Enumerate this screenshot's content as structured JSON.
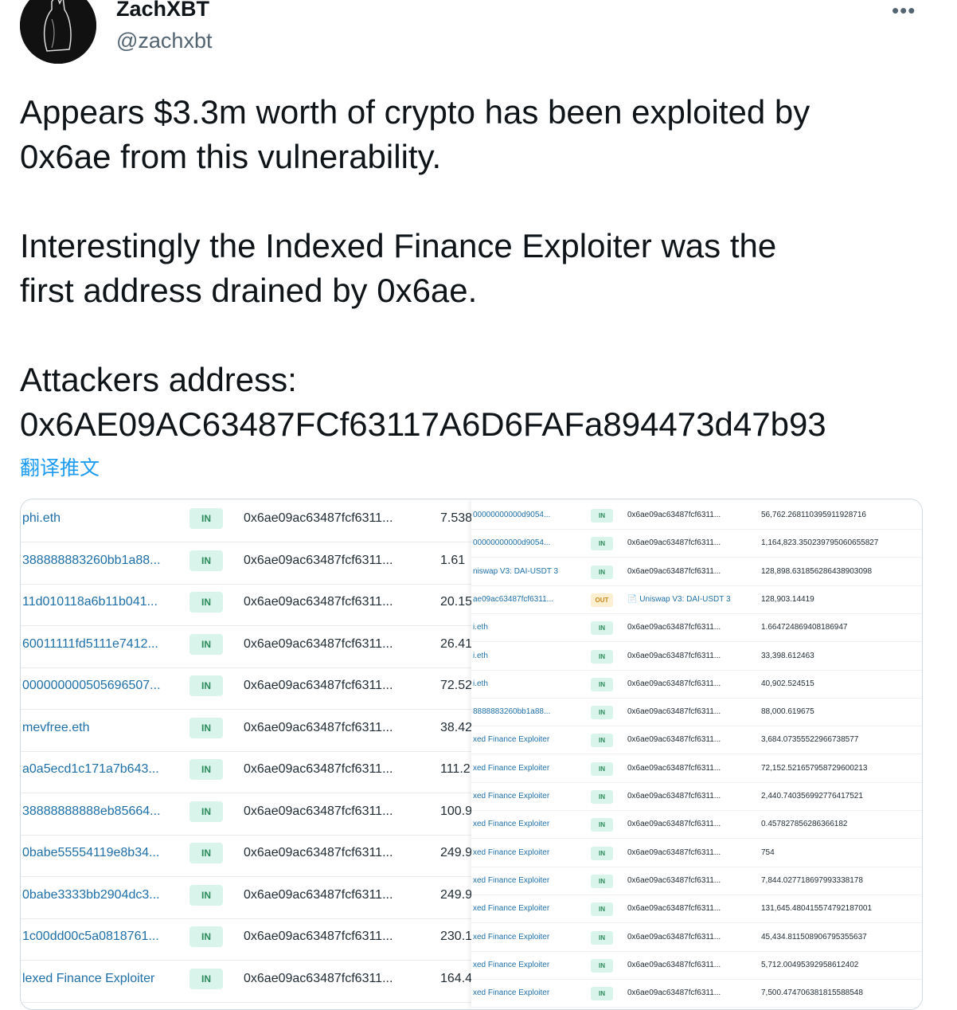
{
  "author": {
    "display_name": "ZachXBT",
    "handle": "@zachxbt"
  },
  "more_label": "•••",
  "tweet": {
    "text": "Appears $3.3m worth of crypto has been exploited by\n0x6ae from this vulnerability.\n\nInterestingly the Indexed Finance Exploiter was the\nfirst address drained by 0x6ae.\n\nAttackers address:\n0x6AE09AC63487FCf63117A6D6FAFa894473d47b93",
    "translate_label": "翻译推文"
  },
  "left_table": {
    "rows": [
      {
        "from": "phi.eth",
        "dir": "IN",
        "to": "0x6ae09ac63487fcf6311...",
        "amount": "7.538"
      },
      {
        "from": "388888883260bb1a88...",
        "dir": "IN",
        "to": "0x6ae09ac63487fcf6311...",
        "amount": "1.61"
      },
      {
        "from": "11d010118a6b11b041...",
        "dir": "IN",
        "to": "0x6ae09ac63487fcf6311...",
        "amount": "20.15"
      },
      {
        "from": "60011111fd5111e7412...",
        "dir": "IN",
        "to": "0x6ae09ac63487fcf6311...",
        "amount": "26.41"
      },
      {
        "from": "000000000505696507...",
        "dir": "IN",
        "to": "0x6ae09ac63487fcf6311...",
        "amount": "72.52"
      },
      {
        "from": "mevfree.eth",
        "dir": "IN",
        "to": "0x6ae09ac63487fcf6311...",
        "amount": "38.42"
      },
      {
        "from": "a0a5ecd1c171a7b643...",
        "dir": "IN",
        "to": "0x6ae09ac63487fcf6311...",
        "amount": "111.2"
      },
      {
        "from": "38888888888eb85664...",
        "dir": "IN",
        "to": "0x6ae09ac63487fcf6311...",
        "amount": "100.9"
      },
      {
        "from": "0babe55554119e8b34...",
        "dir": "IN",
        "to": "0x6ae09ac63487fcf6311...",
        "amount": "249.9"
      },
      {
        "from": "0babe3333bb2904dc3...",
        "dir": "IN",
        "to": "0x6ae09ac63487fcf6311...",
        "amount": "249.9"
      },
      {
        "from": "1c00dd00c5a0818761...",
        "dir": "IN",
        "to": "0x6ae09ac63487fcf6311...",
        "amount": "230.1"
      },
      {
        "from": "lexed Finance Exploiter",
        "dir": "IN",
        "to": "0x6ae09ac63487fcf6311...",
        "amount": "164.4"
      }
    ]
  },
  "right_table": {
    "rows": [
      {
        "from": "00000000000d9054...",
        "dir": "IN",
        "to": "0x6ae09ac63487fcf6311...",
        "amount": "56,762.268110395911928716"
      },
      {
        "from": "00000000000d9054...",
        "dir": "IN",
        "to": "0x6ae09ac63487fcf6311...",
        "amount": "1,164,823.350239795060655827"
      },
      {
        "from": "niswap V3: DAI-USDT 3",
        "dir": "IN",
        "to": "0x6ae09ac63487fcf6311...",
        "amount": "128,898.631856286438903098"
      },
      {
        "from": "ae09ac63487fcf6311...",
        "dir": "OUT",
        "to": "Uniswap V3: DAI-USDT 3",
        "amount": "128,903.14419"
      },
      {
        "from": "i.eth",
        "dir": "IN",
        "to": "0x6ae09ac63487fcf6311...",
        "amount": "1.664724869408186947"
      },
      {
        "from": "i.eth",
        "dir": "IN",
        "to": "0x6ae09ac63487fcf6311...",
        "amount": "33,398.612463"
      },
      {
        "from": "i.eth",
        "dir": "IN",
        "to": "0x6ae09ac63487fcf6311...",
        "amount": "40,902.524515"
      },
      {
        "from": "8888883260bb1a88...",
        "dir": "IN",
        "to": "0x6ae09ac63487fcf6311...",
        "amount": "88,000.619675"
      },
      {
        "from": "xed Finance Exploiter",
        "dir": "IN",
        "to": "0x6ae09ac63487fcf6311...",
        "amount": "3,684.07355522966738577"
      },
      {
        "from": "xed Finance Exploiter",
        "dir": "IN",
        "to": "0x6ae09ac63487fcf6311...",
        "amount": "72,152.521657958729600213"
      },
      {
        "from": "xed Finance Exploiter",
        "dir": "IN",
        "to": "0x6ae09ac63487fcf6311...",
        "amount": "2,440.740356992776417521"
      },
      {
        "from": "xed Finance Exploiter",
        "dir": "IN",
        "to": "0x6ae09ac63487fcf6311...",
        "amount": "0.457827856286366182"
      },
      {
        "from": "xed Finance Exploiter",
        "dir": "IN",
        "to": "0x6ae09ac63487fcf6311...",
        "amount": "754"
      },
      {
        "from": "xed Finance Exploiter",
        "dir": "IN",
        "to": "0x6ae09ac63487fcf6311...",
        "amount": "7,844.027718697993338178"
      },
      {
        "from": "xed Finance Exploiter",
        "dir": "IN",
        "to": "0x6ae09ac63487fcf6311...",
        "amount": "131,645.480415574792187001"
      },
      {
        "from": "xed Finance Exploiter",
        "dir": "IN",
        "to": "0x6ae09ac63487fcf6311...",
        "amount": "45,434.811508906795355637"
      },
      {
        "from": "xed Finance Exploiter",
        "dir": "IN",
        "to": "0x6ae09ac63487fcf6311...",
        "amount": "5,712.004953929586124​02"
      },
      {
        "from": "xed Finance Exploiter",
        "dir": "IN",
        "to": "0x6ae09ac63487fcf6311...",
        "amount": "7,500.474706381815588548"
      }
    ]
  }
}
